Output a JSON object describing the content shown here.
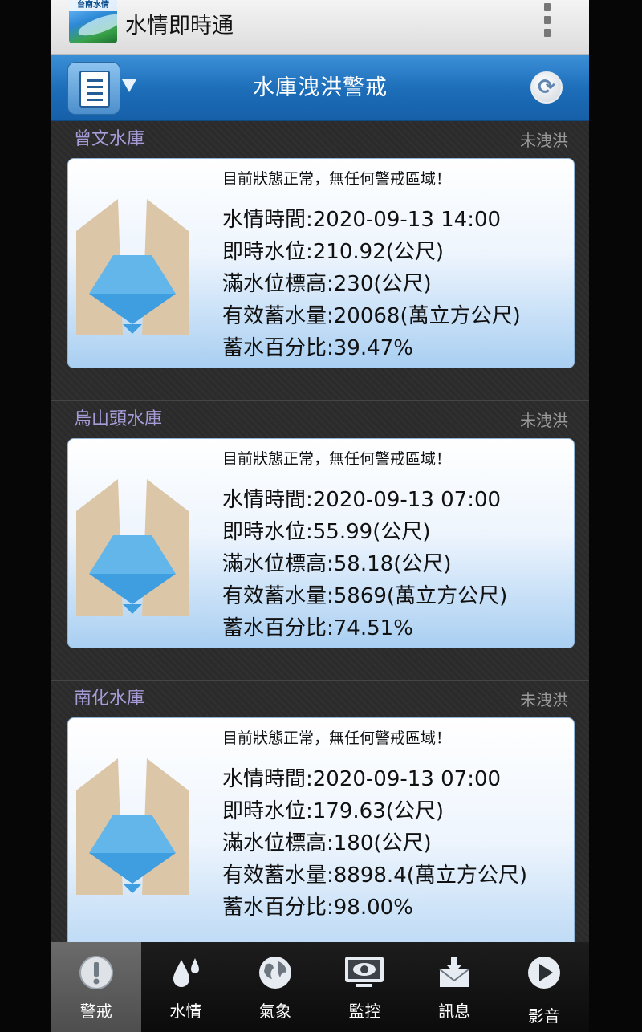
{
  "app": {
    "logo_text": "台南水情",
    "title": "水情即時通"
  },
  "header": {
    "title": "水庫洩洪警戒"
  },
  "reservoirs": [
    {
      "name": "曾文水庫",
      "status": "未洩洪",
      "alert": "目前狀態正常，無任何警戒區域！",
      "time": "水情時間:2020-09-13 14:00",
      "level": "即時水位:210.92(公尺)",
      "full_level": "滿水位標高:230(公尺)",
      "storage": "有效蓄水量:20068(萬立方公尺)",
      "percent": "蓄水百分比:39.47%"
    },
    {
      "name": "烏山頭水庫",
      "status": "未洩洪",
      "alert": "目前狀態正常，無任何警戒區域！",
      "time": "水情時間:2020-09-13 07:00",
      "level": "即時水位:55.99(公尺)",
      "full_level": "滿水位標高:58.18(公尺)",
      "storage": "有效蓄水量:5869(萬立方公尺)",
      "percent": "蓄水百分比:74.51%"
    },
    {
      "name": "南化水庫",
      "status": "未洩洪",
      "alert": "目前狀態正常，無任何警戒區域！",
      "time": "水情時間:2020-09-13 07:00",
      "level": "即時水位:179.63(公尺)",
      "full_level": "滿水位標高:180(公尺)",
      "storage": "有效蓄水量:8898.4(萬立方公尺)",
      "percent": "蓄水百分比:98.00%"
    }
  ],
  "nav": [
    {
      "label": "警戒",
      "icon": "alert-icon",
      "active": true
    },
    {
      "label": "水情",
      "icon": "water-drop-icon",
      "active": false
    },
    {
      "label": "氣象",
      "icon": "globe-icon",
      "active": false
    },
    {
      "label": "監控",
      "icon": "monitor-eye-icon",
      "active": false
    },
    {
      "label": "訊息",
      "icon": "mail-download-icon",
      "active": false
    },
    {
      "label": "影音",
      "icon": "play-icon",
      "active": false
    }
  ],
  "colors": {
    "header_blue": "#1c6cb8",
    "reservoir_name": "#a79cd8",
    "status_gray": "#9a9a9a"
  }
}
